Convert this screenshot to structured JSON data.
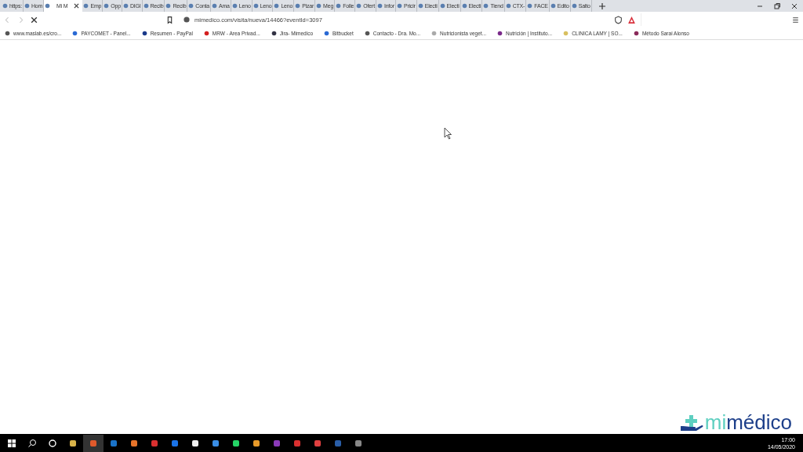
{
  "tabs": [
    {
      "label": "https:",
      "selected": false
    },
    {
      "label": "Hom",
      "selected": false
    },
    {
      "label": "Mi M",
      "selected": true
    },
    {
      "label": "Emp",
      "selected": false
    },
    {
      "label": "Opp",
      "selected": false
    },
    {
      "label": "DIGI",
      "selected": false
    },
    {
      "label": "Recib",
      "selected": false
    },
    {
      "label": "Recib",
      "selected": false
    },
    {
      "label": "Conta",
      "selected": false
    },
    {
      "label": "Ama",
      "selected": false
    },
    {
      "label": "Leno",
      "selected": false
    },
    {
      "label": "Leno",
      "selected": false
    },
    {
      "label": "Leno",
      "selected": false
    },
    {
      "label": "Pizar",
      "selected": false
    },
    {
      "label": "Meg",
      "selected": false
    },
    {
      "label": "Folle",
      "selected": false
    },
    {
      "label": "Ofert",
      "selected": false
    },
    {
      "label": "Infor",
      "selected": false
    },
    {
      "label": "Pricir",
      "selected": false
    },
    {
      "label": "Electi",
      "selected": false
    },
    {
      "label": "Electi",
      "selected": false
    },
    {
      "label": "Electi",
      "selected": false
    },
    {
      "label": "Tiend",
      "selected": false
    },
    {
      "label": "CTX-",
      "selected": false
    },
    {
      "label": "FACE",
      "selected": false
    },
    {
      "label": "Edito",
      "selected": false
    },
    {
      "label": "Salto",
      "selected": false
    }
  ],
  "address": {
    "value": "mimedico.com/visita/nueva/14466?eventId=3097"
  },
  "bookmarks": [
    "www.maslab.es/cro...",
    "PAYCOMET - Panel...",
    "Resumen - PayPal",
    "MRW - Area Privad...",
    "Jira- Mimedico",
    "Bitbucket",
    "Contacto - Dra. Mo...",
    "Nutricionista veget...",
    "Nutrición | Instituto...",
    "CLINICA LAMY | SO...",
    "Método Sarai Alonso"
  ],
  "logo": {
    "light": "mi",
    "dark": "médico"
  },
  "taskbar": {
    "time": "17:00",
    "date": "14/05/2020"
  }
}
